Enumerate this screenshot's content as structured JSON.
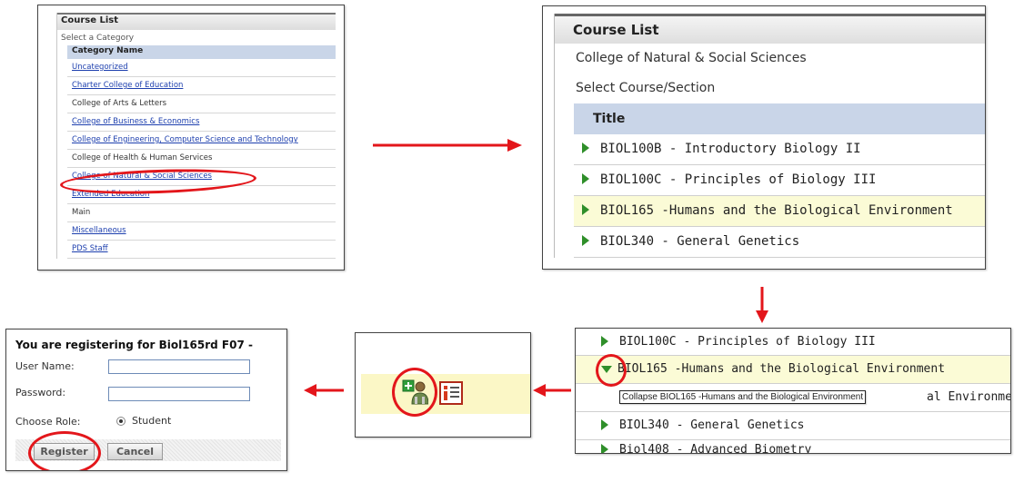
{
  "panel_category": {
    "header": "Course List",
    "subtitle": "Select a Category",
    "column_header": "Category Name",
    "categories": [
      {
        "label": "Uncategorized"
      },
      {
        "label": "Charter College of Education"
      },
      {
        "label": "College of Arts & Letters"
      },
      {
        "label": "College of Business & Economics"
      },
      {
        "label": "College of Engineering, Computer Science and Technology"
      },
      {
        "label": "College of Health & Human Services"
      },
      {
        "label": "College of Natural & Social Sciences"
      },
      {
        "label": "Extended Education"
      },
      {
        "label": "Main"
      },
      {
        "label": "Miscellaneous"
      },
      {
        "label": "PDS Staff"
      }
    ]
  },
  "panel_course": {
    "header": "Course List",
    "college": "College of Natural & Social Sciences",
    "select_label": "Select Course/Section",
    "column_header": "Title",
    "courses": [
      {
        "label": "BIOL100B - Introductory Biology II"
      },
      {
        "label": "BIOL100C - Principles of Biology III"
      },
      {
        "label": "BIOL165 -Humans and the Biological Environment"
      },
      {
        "label": "BIOL340 - General Genetics"
      }
    ]
  },
  "panel_expanded": {
    "rows": [
      {
        "label": "BIOL100C - Principles of Biology III"
      },
      {
        "label": "BIOL165 -Humans and the Biological Environment"
      },
      {
        "label": "al Environment"
      },
      {
        "label": "BIOL340 - General Genetics"
      },
      {
        "label": "Biol408 - Advanced Biometry"
      }
    ],
    "tooltip": "Collapse BIOL165 -Humans and the Biological Environment"
  },
  "panel_icons": {
    "icons": [
      "register-user-icon",
      "course-info-icon"
    ]
  },
  "panel_register": {
    "title": "You are registering for Biol165rd  F07 -",
    "username_label": "User Name:",
    "password_label": "Password:",
    "role_label": "Choose Role:",
    "role_value": "Student",
    "register_button": "Register",
    "cancel_button": "Cancel"
  },
  "colors": {
    "highlight_ring": "#e3161b",
    "table_header": "#c9d5e8",
    "row_highlight": "#fbfbd6",
    "link": "#1d3fae"
  }
}
